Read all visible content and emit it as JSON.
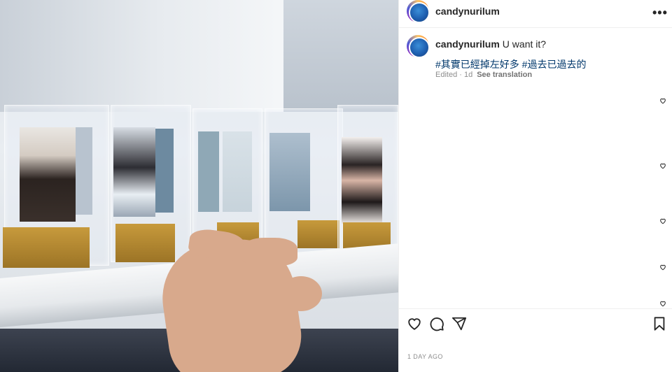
{
  "post": {
    "username": "candynurilum",
    "caption_text": "U want it?",
    "hashtags": "#其實已經掉左好多 #過去已過去的",
    "edited_label": "Edited · 1d",
    "see_translation": "See translation",
    "date": "1 DAY AGO",
    "more_label": "•••"
  },
  "icons": {
    "more": "more-horizontal-icon",
    "like": "heart-icon",
    "comment": "comment-icon",
    "share": "send-icon",
    "save": "bookmark-icon",
    "comment_like": "small-heart-icon"
  },
  "colors": {
    "hashtag": "#00376b",
    "muted": "#8e8e8e",
    "text": "#262626"
  }
}
